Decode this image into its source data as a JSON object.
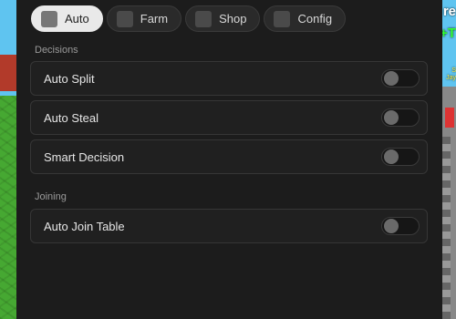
{
  "tabs": [
    {
      "label": "Auto",
      "icon": "auto-icon",
      "active": true
    },
    {
      "label": "Farm",
      "icon": "farm-icon",
      "active": false
    },
    {
      "label": "Shop",
      "icon": "shop-icon",
      "active": false
    },
    {
      "label": "Config",
      "icon": "config-icon",
      "active": false
    }
  ],
  "sections": [
    {
      "title": "Decisions",
      "items": [
        {
          "label": "Auto Split",
          "enabled": false
        },
        {
          "label": "Auto Steal",
          "enabled": false
        },
        {
          "label": "Smart Decision",
          "enabled": false
        }
      ]
    },
    {
      "title": "Joining",
      "items": [
        {
          "label": "Auto Join Table",
          "enabled": false
        }
      ]
    }
  ],
  "background": {
    "sign_top": "re",
    "sign_green": "+T",
    "sign_small_line1": "S",
    "sign_small_line2": "Jay"
  },
  "colors": {
    "panel": "#1c1c1c",
    "row": "#202020",
    "active_tab": "#e9e9e9",
    "toggle_off": "#6a6a6a"
  }
}
